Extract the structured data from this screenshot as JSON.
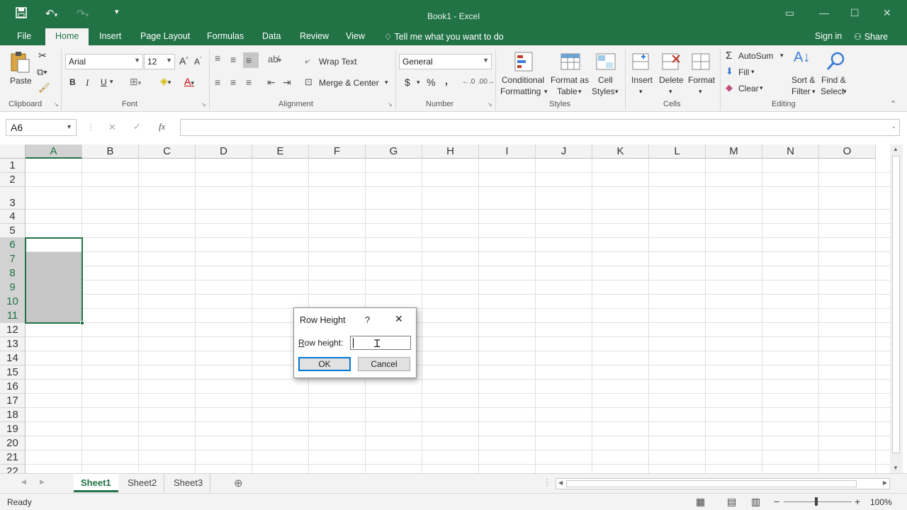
{
  "window": {
    "title": "Book1 - Excel"
  },
  "tabs": [
    {
      "label": "File"
    },
    {
      "label": "Home"
    },
    {
      "label": "Insert"
    },
    {
      "label": "Page Layout"
    },
    {
      "label": "Formulas"
    },
    {
      "label": "Data"
    },
    {
      "label": "Review"
    },
    {
      "label": "View"
    }
  ],
  "tell_me": "Tell me what you want to do",
  "account": {
    "sign_in": "Sign in",
    "share": "Share"
  },
  "ribbon": {
    "clipboard": {
      "group": "Clipboard",
      "paste": "Paste"
    },
    "font": {
      "group": "Font",
      "name": "Arial",
      "size": "12",
      "bold": "B",
      "italic": "I",
      "underline": "U"
    },
    "alignment": {
      "group": "Alignment",
      "wrap_text": "Wrap Text",
      "merge_center": "Merge & Center"
    },
    "number": {
      "group": "Number",
      "format": "General",
      "currency": "$",
      "percent": "%",
      "comma": ","
    },
    "styles": {
      "group": "Styles",
      "conditional_1": "Conditional",
      "conditional_2": "Formatting",
      "format_table_1": "Format as",
      "format_table_2": "Table",
      "cell_styles_1": "Cell",
      "cell_styles_2": "Styles"
    },
    "cells": {
      "group": "Cells",
      "insert": "Insert",
      "delete": "Delete",
      "format": "Format"
    },
    "editing": {
      "group": "Editing",
      "autosum": "AutoSum",
      "fill": "Fill",
      "clear": "Clear",
      "sort_1": "Sort &",
      "sort_2": "Filter",
      "find_1": "Find &",
      "find_2": "Select"
    }
  },
  "formula_bar": {
    "name_box": "A6",
    "cancel": "✕",
    "enter": "✓",
    "fx": "fx",
    "value": ""
  },
  "grid": {
    "columns": [
      "A",
      "B",
      "C",
      "D",
      "E",
      "F",
      "G",
      "H",
      "I",
      "J",
      "K",
      "L",
      "M",
      "N",
      "O"
    ],
    "rows": [
      "1",
      "2",
      "3",
      "4",
      "5",
      "6",
      "7",
      "8",
      "9",
      "10",
      "11",
      "12",
      "13",
      "14",
      "15",
      "16",
      "17",
      "18",
      "19",
      "20",
      "21",
      "22"
    ],
    "selected_column": "A",
    "selected_rows": [
      "6",
      "7",
      "8",
      "9",
      "10",
      "11"
    ]
  },
  "sheets": [
    {
      "label": "Sheet1"
    },
    {
      "label": "Sheet2"
    },
    {
      "label": "Sheet3"
    }
  ],
  "active_sheet": "Sheet1",
  "status": {
    "ready": "Ready",
    "zoom": "100%"
  },
  "dialog": {
    "title": "Row Height",
    "help": "?",
    "close": "✕",
    "field_label": "Row height:",
    "field_value": "",
    "ok": "OK",
    "cancel": "Cancel"
  },
  "colors": {
    "accent": "#217346",
    "selection_fill": "#c6c6c6",
    "default_button": "#0078d7"
  }
}
